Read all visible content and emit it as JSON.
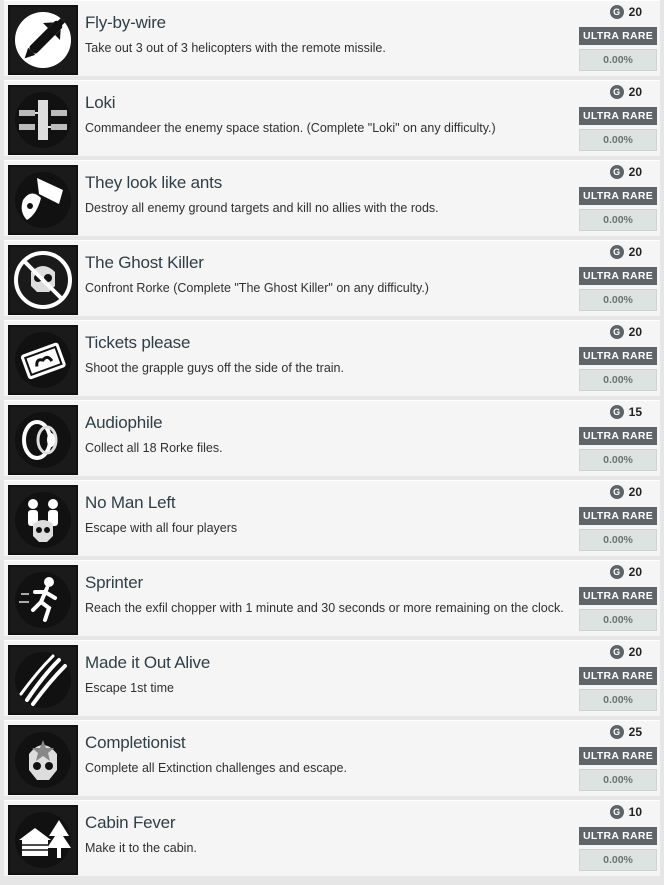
{
  "achievements": [
    {
      "title": "Fly-by-wire",
      "description": "Take out 3 out of 3 helicopters with the remote missile.",
      "points": "20",
      "rarity": "ULTRA RARE",
      "percent": "0.00%",
      "icon": "missile-icon"
    },
    {
      "title": "Loki",
      "description": "Commandeer the enemy space station. (Complete \"Loki\" on any difficulty.)",
      "points": "20",
      "rarity": "ULTRA RARE",
      "percent": "0.00%",
      "icon": "space-station-icon"
    },
    {
      "title": "They look like ants",
      "description": "Destroy all enemy ground targets and kill no allies with the rods.",
      "points": "20",
      "rarity": "ULTRA RARE",
      "percent": "0.00%",
      "icon": "rods-strike-icon"
    },
    {
      "title": "The Ghost Killer",
      "description": "Confront Rorke (Complete \"The Ghost Killer\" on any difficulty.)",
      "points": "20",
      "rarity": "ULTRA RARE",
      "percent": "0.00%",
      "icon": "ghost-skull-prohibited-icon"
    },
    {
      "title": "Tickets please",
      "description": "Shoot the grapple guys off the side of the train.",
      "points": "20",
      "rarity": "ULTRA RARE",
      "percent": "0.00%",
      "icon": "ticket-icon"
    },
    {
      "title": "Audiophile",
      "description": "Collect all 18 Rorke files.",
      "points": "15",
      "rarity": "ULTRA RARE",
      "percent": "0.00%",
      "icon": "audio-reel-icon"
    },
    {
      "title": "No Man Left",
      "description": "Escape with all four players",
      "points": "20",
      "rarity": "ULTRA RARE",
      "percent": "0.00%",
      "icon": "soldiers-skull-icon"
    },
    {
      "title": "Sprinter",
      "description": "Reach the exfil chopper with 1 minute and 30 seconds or more remaining on the clock.",
      "points": "20",
      "rarity": "ULTRA RARE",
      "percent": "0.00%",
      "icon": "running-man-icon"
    },
    {
      "title": "Made it Out Alive",
      "description": "Escape 1st time",
      "points": "20",
      "rarity": "ULTRA RARE",
      "percent": "0.00%",
      "icon": "claw-marks-icon"
    },
    {
      "title": "Completionist",
      "description": "Complete all Extinction challenges and escape.",
      "points": "25",
      "rarity": "ULTRA RARE",
      "percent": "0.00%",
      "icon": "skull-star-icon"
    },
    {
      "title": "Cabin Fever",
      "description": "Make it to the cabin.",
      "points": "10",
      "rarity": "ULTRA RARE",
      "percent": "0.00%",
      "icon": "cabin-tree-icon"
    }
  ],
  "score_badge_letter": "G",
  "colors": {
    "title": "#2e3f48",
    "rarity_badge": "#5f6568",
    "percent_box": "#dde3e0",
    "icon_bg": "#1a1a1a"
  }
}
